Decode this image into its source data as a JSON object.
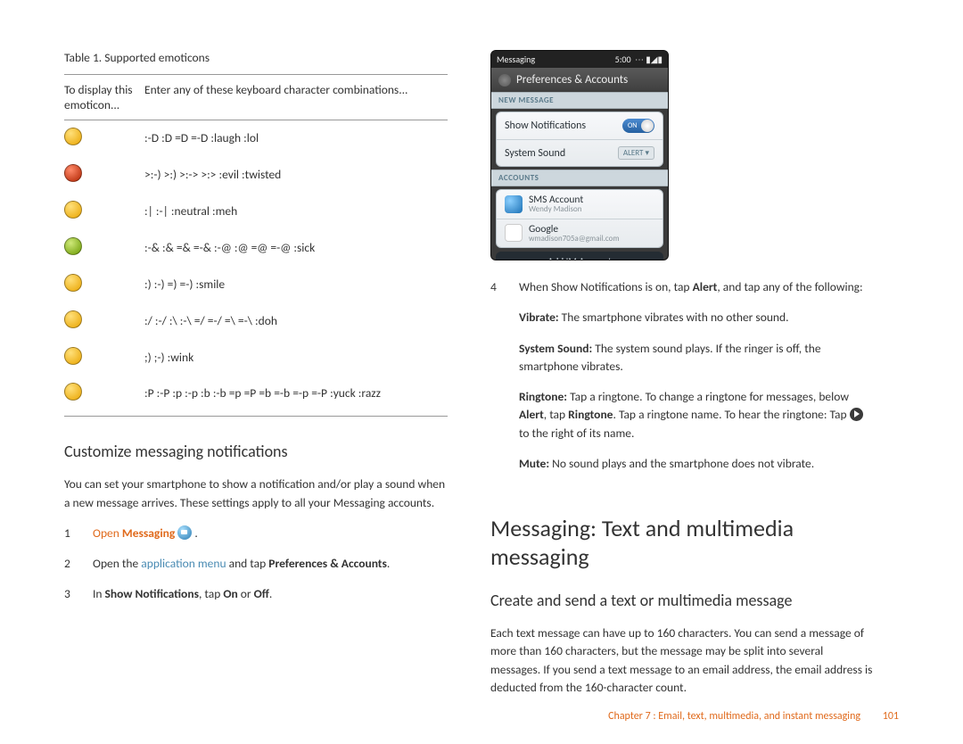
{
  "leftColumn": {
    "tableCaption": "Table 1.  Supported emoticons",
    "th1": "To display this emoticon...",
    "th2": "Enter any of these keyboard character combinations...",
    "rows": [
      {
        "color": "y",
        "text": ":-D    :D    =D    =-D    :laugh    :lol"
      },
      {
        "color": "r",
        "text": ">:-)    >:)    >:->    >:>    :evil    :twisted"
      },
      {
        "color": "y",
        "text": ":|    :-|    :neutral    :meh"
      },
      {
        "color": "g",
        "text": ":-&    :&    =&    =-&    :-@    :@    =@    =-@    :sick"
      },
      {
        "color": "y",
        "text": ":)    :-)    =)    =-)    :smile"
      },
      {
        "color": "y",
        "text": ":/    :-/    :\\    :-\\    =/    =-/    =\\    =-\\    :doh"
      },
      {
        "color": "y",
        "text": ";)    ;-)    :wink"
      },
      {
        "color": "y",
        "text": ":P    :-P    :p    :-p    :b    :-b    =p    =P    =b    =-b    =-p    =-P    :yuck    :razz"
      }
    ],
    "sectionHeading": "Customize messaging notifications",
    "intro": "You can set your smartphone to show a notification and/or play a sound when a new message arrives. These settings apply to all your Messaging accounts.",
    "step1_open": "Open",
    "step1_msg": " Messaging ",
    "step1_dot": ".",
    "step2_a": "Open the ",
    "step2_link": "application menu",
    "step2_b": " and tap ",
    "step2_bold": "Preferences & Accounts",
    "step2_c": ".",
    "step3_a": "In ",
    "step3_bold": "Show Notifications",
    "step3_b": ", tap ",
    "step3_on": "On",
    "step3_or": " or ",
    "step3_off": "Off",
    "step3_c": "."
  },
  "phone": {
    "statusL": "Messaging",
    "statusTime": "5:00",
    "prefs": "Preferences & Accounts",
    "hdr1": "NEW MESSAGE",
    "row1": "Show Notifications",
    "toggle": "ON",
    "row2": "System Sound",
    "alert": "ALERT",
    "hdr2": "ACCOUNTS",
    "acct1n": "SMS Account",
    "acct1s": "Wendy Madison",
    "acct2n": "Google",
    "acct2s": "wmadison705a@gmail.com",
    "add": "Add IM Account"
  },
  "rightColumn": {
    "step4num": "4",
    "step4_a": "When Show Notifications is on, tap ",
    "step4_bold": "Alert",
    "step4_b": ", and tap any of the following:",
    "vib_h": "Vibrate:",
    "vib_t": " The smartphone vibrates with no other sound.",
    "sys_h": "System Sound:",
    "sys_t": " The system sound plays. If the ringer is off, the smartphone vibrates.",
    "ring_h": "Ringtone:",
    "ring_a": " Tap a ringtone. To change a ringtone for messages, below ",
    "ring_b1": "Alert",
    "ring_b": ", tap ",
    "ring_b2": "Ringtone",
    "ring_c": ". Tap a ringtone name. To hear the ringtone: Tap ",
    "ring_d": " to the right of its name.",
    "mute_h": "Mute:",
    "mute_t": " No sound plays and the smartphone does not vibrate.",
    "h1": "Messaging: Text and multimedia messaging",
    "h2": "Create and send a text or multimedia message",
    "para": "Each text message can have up to 160 characters. You can send a message of more than 160 characters, but the message may be split into several messages. If you send a text message to an email address, the email address is deducted from the 160-character count."
  },
  "footer": {
    "chapter": "Chapter 7 : Email, text, multimedia, and instant messaging",
    "page": "101"
  }
}
